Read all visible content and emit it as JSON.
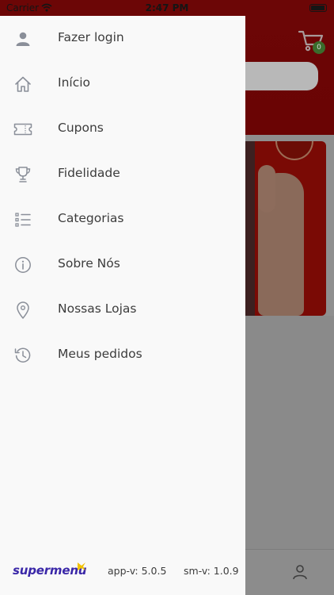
{
  "status_bar": {
    "carrier": "Carrier",
    "time": "2:47 PM"
  },
  "background": {
    "cart_count": "0"
  },
  "menu": {
    "items": [
      {
        "label": "Fazer login",
        "icon": "user-icon"
      },
      {
        "label": "Início",
        "icon": "home-icon"
      },
      {
        "label": "Cupons",
        "icon": "ticket-icon"
      },
      {
        "label": "Fidelidade",
        "icon": "trophy-icon"
      },
      {
        "label": "Categorias",
        "icon": "list-icon"
      },
      {
        "label": "Sobre Nós",
        "icon": "info-icon"
      },
      {
        "label": "Nossas Lojas",
        "icon": "location-pin-icon"
      },
      {
        "label": "Meus pedidos",
        "icon": "history-icon"
      }
    ]
  },
  "footer": {
    "brand": "supermenu",
    "app_version": "app-v: 5.0.5",
    "sm_version": "sm-v: 1.0.9"
  },
  "colors": {
    "brand": "#3a27a8",
    "brand_accent": "#f2c200",
    "header_red": "#6c0606",
    "icon_gray": "#8a8f99",
    "text": "#3c3c3c"
  }
}
